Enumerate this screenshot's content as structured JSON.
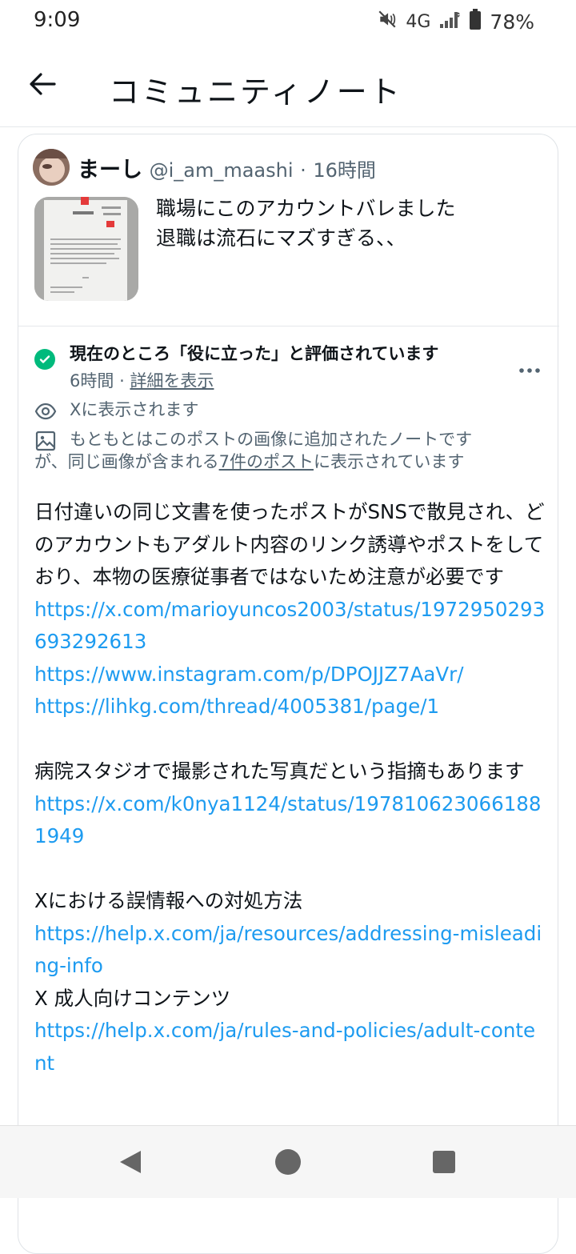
{
  "status_bar": {
    "time": "9:09",
    "network": "4G",
    "battery": "78%",
    "icons": [
      "mute-icon",
      "signal-icon",
      "battery-icon"
    ]
  },
  "header": {
    "title": "コミュニティノート",
    "back_icon": "back-arrow-icon"
  },
  "post": {
    "name": "まーし",
    "handle": "@i_am_maashi",
    "separator": "·",
    "time": "16時間",
    "text_line1": "職場にこのアカウントバレました",
    "text_line2": "退職は流石にマズすぎる、、"
  },
  "note": {
    "status_title": "現在のところ「役に立った」と評価されています",
    "status_time": "6時間",
    "status_separator": "·",
    "status_details": "詳細を表示",
    "visible_text": "Xに表示されます",
    "image_note_line1": "もともとはこのポストの画像に追加されたノートです",
    "image_note_line2_pre": "が、同じ画像が含まれる",
    "image_note_link": "7件のポスト",
    "image_note_line2_post": "に表示されています",
    "body_paragraph1": "日付違いの同じ文書を使ったポストがSNSで散見され、どのアカウントもアダルト内容のリンク誘導やポストをしており、本物の医療従事者ではないため注意が必要です",
    "link1": "https://x.com/marioyuncos2003/status/1972950293693292613",
    "link2": "https://www.instagram.com/p/DPOJJZ7AaVr/",
    "link3": "https://lihkg.com/thread/4005381/page/1",
    "body_paragraph2": "病院スタジオで撮影された写真だという指摘もあります",
    "link4": "https://x.com/k0nya1124/status/1978106230661881949",
    "body_paragraph3": "Xにおける誤情報への対処方法",
    "link5": "https://help.x.com/ja/resources/addressing-misleading-info",
    "body_paragraph4": "X 成人向けコンテンツ",
    "link6": "https://help.x.com/ja/rules-and-policies/adult-content"
  },
  "colors": {
    "accent_link": "#1d9bf0",
    "helpful_green": "#00ba7c",
    "muted_text": "#536471"
  }
}
